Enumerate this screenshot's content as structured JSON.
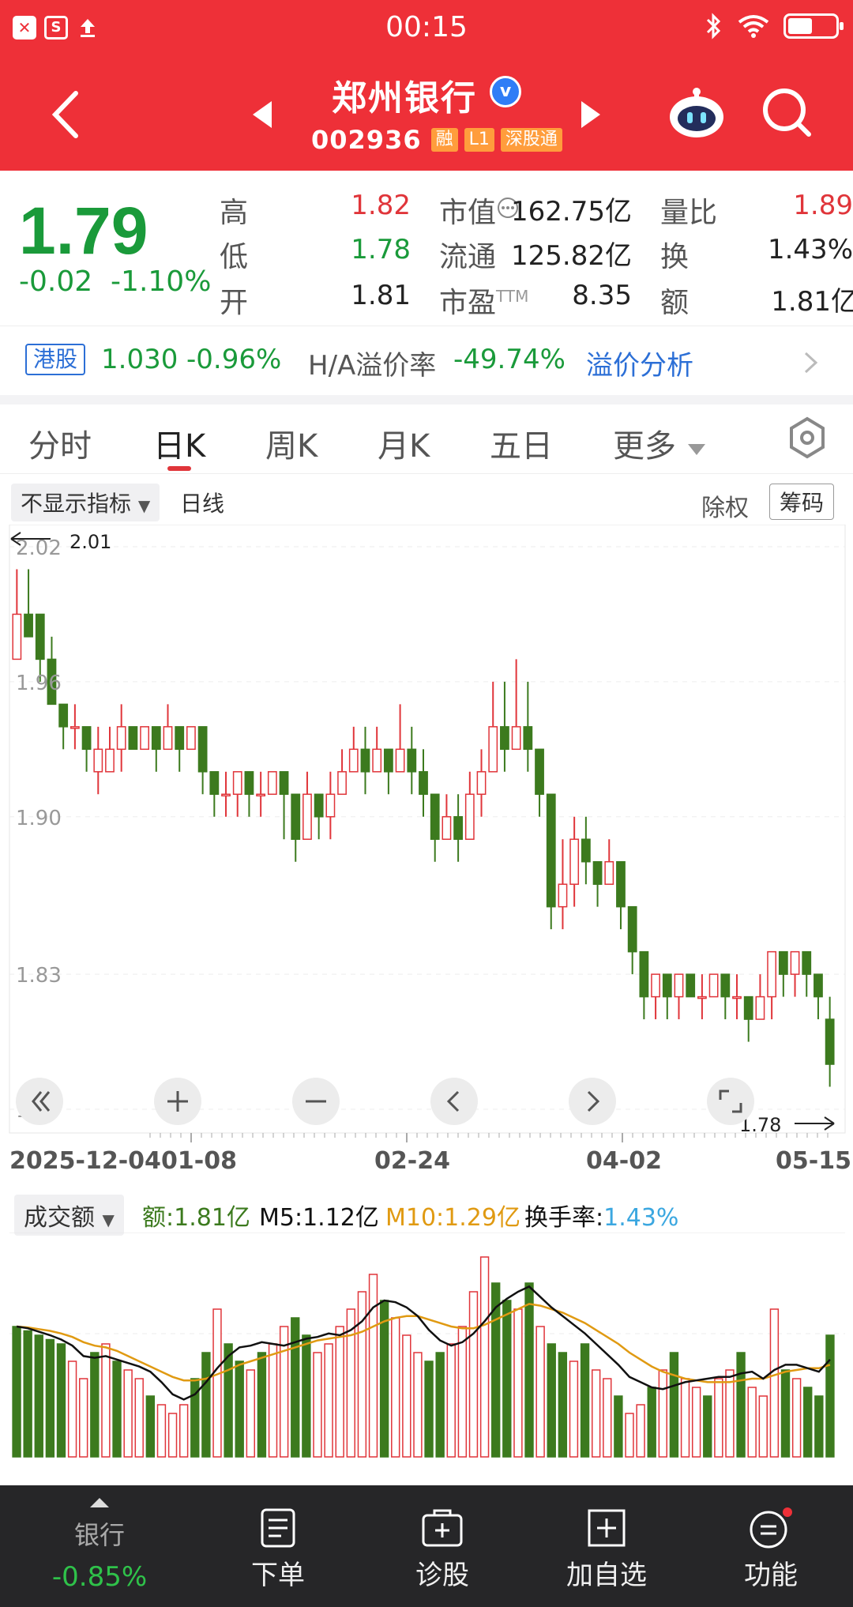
{
  "status_bar": {
    "time": "00:15"
  },
  "header": {
    "stock_name": "郑州银行",
    "verified_mark": "v",
    "stock_code": "002936",
    "tags": [
      "融",
      "L1",
      "深股通"
    ]
  },
  "quote": {
    "price": "1.79",
    "change": "-0.02",
    "change_pct": "-1.10%",
    "high_label": "高",
    "high": "1.82",
    "low_label": "低",
    "low": "1.78",
    "open_label": "开",
    "open": "1.81",
    "mktcap_label": "市值",
    "mktcap": "162.75亿",
    "float_label": "流通",
    "float_cap": "125.82亿",
    "pe_label": "市盈",
    "pe_sup": "TTM",
    "pe": "8.35",
    "volratio_label": "量比",
    "volratio": "1.89",
    "turnover_label": "换",
    "turnover": "1.43%",
    "amount_label": "额",
    "amount": "1.81亿"
  },
  "hk_row": {
    "tag": "港股",
    "price": "1.030",
    "change_pct": "-0.96%",
    "premium_label": "H/A溢价率",
    "premium": "-49.74%",
    "analysis_link": "溢价分析"
  },
  "tabs": [
    "分时",
    "日K",
    "周K",
    "月K",
    "五日",
    "更多"
  ],
  "chart_controls": {
    "indicator_select": "不显示指标",
    "daily_label": "日线",
    "chuquan": "除权",
    "chouma": "筹码"
  },
  "chart_data": {
    "type": "candlestick",
    "y_ticks": [
      "2.02",
      "1.96",
      "1.90",
      "1.83",
      "1.77"
    ],
    "ylim": [
      1.77,
      2.02
    ],
    "max_marker": "2.01",
    "min_marker": "1.78",
    "x_ticks": [
      "2025-12-04",
      "01-08",
      "02-24",
      "04-02",
      "05-15"
    ],
    "colors": {
      "up": "#e0353a",
      "down": "#3c7a1e"
    },
    "candles": [
      {
        "o": 1.97,
        "c": 1.99,
        "h": 2.01,
        "l": 1.97
      },
      {
        "o": 1.99,
        "c": 1.98,
        "h": 2.01,
        "l": 1.98
      },
      {
        "o": 1.99,
        "c": 1.97,
        "h": 1.99,
        "l": 1.96
      },
      {
        "o": 1.97,
        "c": 1.95,
        "h": 1.98,
        "l": 1.95
      },
      {
        "o": 1.95,
        "c": 1.94,
        "h": 1.95,
        "l": 1.93
      },
      {
        "o": 1.94,
        "c": 1.94,
        "h": 1.95,
        "l": 1.93
      },
      {
        "o": 1.94,
        "c": 1.93,
        "h": 1.94,
        "l": 1.92
      },
      {
        "o": 1.92,
        "c": 1.93,
        "h": 1.94,
        "l": 1.91
      },
      {
        "o": 1.92,
        "c": 1.93,
        "h": 1.94,
        "l": 1.92
      },
      {
        "o": 1.93,
        "c": 1.94,
        "h": 1.95,
        "l": 1.92
      },
      {
        "o": 1.94,
        "c": 1.93,
        "h": 1.94,
        "l": 1.93
      },
      {
        "o": 1.93,
        "c": 1.94,
        "h": 1.94,
        "l": 1.93
      },
      {
        "o": 1.94,
        "c": 1.93,
        "h": 1.94,
        "l": 1.92
      },
      {
        "o": 1.93,
        "c": 1.94,
        "h": 1.95,
        "l": 1.93
      },
      {
        "o": 1.94,
        "c": 1.93,
        "h": 1.94,
        "l": 1.92
      },
      {
        "o": 1.93,
        "c": 1.94,
        "h": 1.94,
        "l": 1.93
      },
      {
        "o": 1.94,
        "c": 1.92,
        "h": 1.94,
        "l": 1.91
      },
      {
        "o": 1.92,
        "c": 1.91,
        "h": 1.92,
        "l": 1.9
      },
      {
        "o": 1.91,
        "c": 1.91,
        "h": 1.92,
        "l": 1.9
      },
      {
        "o": 1.91,
        "c": 1.92,
        "h": 1.92,
        "l": 1.9
      },
      {
        "o": 1.92,
        "c": 1.91,
        "h": 1.92,
        "l": 1.9
      },
      {
        "o": 1.91,
        "c": 1.91,
        "h": 1.92,
        "l": 1.9
      },
      {
        "o": 1.91,
        "c": 1.92,
        "h": 1.92,
        "l": 1.91
      },
      {
        "o": 1.92,
        "c": 1.91,
        "h": 1.92,
        "l": 1.89
      },
      {
        "o": 1.91,
        "c": 1.89,
        "h": 1.91,
        "l": 1.88
      },
      {
        "o": 1.89,
        "c": 1.91,
        "h": 1.92,
        "l": 1.89
      },
      {
        "o": 1.91,
        "c": 1.9,
        "h": 1.91,
        "l": 1.89
      },
      {
        "o": 1.9,
        "c": 1.91,
        "h": 1.92,
        "l": 1.89
      },
      {
        "o": 1.91,
        "c": 1.92,
        "h": 1.93,
        "l": 1.91
      },
      {
        "o": 1.92,
        "c": 1.93,
        "h": 1.94,
        "l": 1.92
      },
      {
        "o": 1.93,
        "c": 1.92,
        "h": 1.94,
        "l": 1.91
      },
      {
        "o": 1.92,
        "c": 1.93,
        "h": 1.94,
        "l": 1.92
      },
      {
        "o": 1.93,
        "c": 1.92,
        "h": 1.93,
        "l": 1.91
      },
      {
        "o": 1.92,
        "c": 1.93,
        "h": 1.95,
        "l": 1.92
      },
      {
        "o": 1.93,
        "c": 1.92,
        "h": 1.94,
        "l": 1.91
      },
      {
        "o": 1.92,
        "c": 1.91,
        "h": 1.93,
        "l": 1.9
      },
      {
        "o": 1.91,
        "c": 1.89,
        "h": 1.91,
        "l": 1.88
      },
      {
        "o": 1.89,
        "c": 1.9,
        "h": 1.91,
        "l": 1.89
      },
      {
        "o": 1.9,
        "c": 1.89,
        "h": 1.91,
        "l": 1.88
      },
      {
        "o": 1.89,
        "c": 1.91,
        "h": 1.92,
        "l": 1.89
      },
      {
        "o": 1.91,
        "c": 1.92,
        "h": 1.93,
        "l": 1.9
      },
      {
        "o": 1.92,
        "c": 1.94,
        "h": 1.96,
        "l": 1.92
      },
      {
        "o": 1.94,
        "c": 1.93,
        "h": 1.96,
        "l": 1.92
      },
      {
        "o": 1.93,
        "c": 1.94,
        "h": 1.97,
        "l": 1.93
      },
      {
        "o": 1.94,
        "c": 1.93,
        "h": 1.96,
        "l": 1.92
      },
      {
        "o": 1.93,
        "c": 1.91,
        "h": 1.93,
        "l": 1.9
      },
      {
        "o": 1.91,
        "c": 1.86,
        "h": 1.91,
        "l": 1.85
      },
      {
        "o": 1.86,
        "c": 1.87,
        "h": 1.89,
        "l": 1.85
      },
      {
        "o": 1.87,
        "c": 1.89,
        "h": 1.9,
        "l": 1.86
      },
      {
        "o": 1.89,
        "c": 1.88,
        "h": 1.9,
        "l": 1.87
      },
      {
        "o": 1.88,
        "c": 1.87,
        "h": 1.88,
        "l": 1.86
      },
      {
        "o": 1.87,
        "c": 1.88,
        "h": 1.89,
        "l": 1.87
      },
      {
        "o": 1.88,
        "c": 1.86,
        "h": 1.88,
        "l": 1.85
      },
      {
        "o": 1.86,
        "c": 1.84,
        "h": 1.86,
        "l": 1.83
      },
      {
        "o": 1.84,
        "c": 1.82,
        "h": 1.84,
        "l": 1.81
      },
      {
        "o": 1.82,
        "c": 1.83,
        "h": 1.83,
        "l": 1.81
      },
      {
        "o": 1.83,
        "c": 1.82,
        "h": 1.83,
        "l": 1.81
      },
      {
        "o": 1.82,
        "c": 1.83,
        "h": 1.83,
        "l": 1.81
      },
      {
        "o": 1.83,
        "c": 1.82,
        "h": 1.83,
        "l": 1.82
      },
      {
        "o": 1.82,
        "c": 1.82,
        "h": 1.83,
        "l": 1.81
      },
      {
        "o": 1.82,
        "c": 1.83,
        "h": 1.83,
        "l": 1.82
      },
      {
        "o": 1.83,
        "c": 1.82,
        "h": 1.83,
        "l": 1.81
      },
      {
        "o": 1.82,
        "c": 1.82,
        "h": 1.83,
        "l": 1.81
      },
      {
        "o": 1.82,
        "c": 1.81,
        "h": 1.82,
        "l": 1.8
      },
      {
        "o": 1.81,
        "c": 1.82,
        "h": 1.83,
        "l": 1.81
      },
      {
        "o": 1.82,
        "c": 1.84,
        "h": 1.84,
        "l": 1.81
      },
      {
        "o": 1.84,
        "c": 1.83,
        "h": 1.84,
        "l": 1.82
      },
      {
        "o": 1.83,
        "c": 1.84,
        "h": 1.84,
        "l": 1.82
      },
      {
        "o": 1.84,
        "c": 1.83,
        "h": 1.84,
        "l": 1.82
      },
      {
        "o": 1.83,
        "c": 1.82,
        "h": 1.83,
        "l": 1.81
      },
      {
        "o": 1.81,
        "c": 1.79,
        "h": 1.82,
        "l": 1.78
      }
    ]
  },
  "volume_controls": {
    "select": "成交额",
    "amount": "额:1.81亿",
    "m5": "M5:1.12亿",
    "m10": "M10:1.29亿",
    "turnover": "换手率:1.43%"
  },
  "volume_data": {
    "type": "bar",
    "colors": {
      "up": "#e0353a",
      "down": "#3c7a1e",
      "m5": "#111111",
      "m10": "#e09a12"
    },
    "values": [
      1.5,
      1.45,
      1.4,
      1.35,
      1.3,
      1.1,
      0.9,
      1.2,
      1.3,
      1.1,
      1.0,
      0.9,
      0.7,
      0.6,
      0.5,
      0.6,
      0.9,
      1.2,
      1.7,
      1.3,
      1.1,
      1.0,
      1.2,
      1.3,
      1.5,
      1.6,
      1.4,
      1.2,
      1.3,
      1.5,
      1.7,
      1.9,
      2.1,
      1.8,
      1.6,
      1.4,
      1.2,
      1.1,
      1.2,
      1.3,
      1.5,
      1.9,
      2.3,
      2.0,
      1.8,
      1.7,
      2.0,
      1.5,
      1.3,
      1.2,
      1.1,
      1.3,
      1.0,
      0.9,
      0.7,
      0.5,
      0.6,
      0.8,
      1.0,
      1.2,
      0.9,
      0.8,
      0.7,
      0.9,
      1.0,
      1.2,
      0.8,
      0.7,
      1.7,
      1.0,
      0.9,
      0.8,
      0.7,
      1.4
    ],
    "up": [
      false,
      false,
      false,
      false,
      false,
      true,
      true,
      false,
      true,
      false,
      true,
      true,
      false,
      true,
      true,
      true,
      false,
      false,
      true,
      false,
      false,
      true,
      false,
      true,
      true,
      false,
      false,
      true,
      true,
      true,
      true,
      true,
      true,
      false,
      true,
      true,
      true,
      false,
      false,
      true,
      true,
      true,
      true,
      false,
      false,
      true,
      false,
      true,
      false,
      false,
      true,
      false,
      true,
      true,
      false,
      true,
      true,
      false,
      true,
      false,
      true,
      true,
      false,
      true,
      true,
      false,
      true,
      true,
      true,
      false,
      true,
      false,
      false,
      false
    ],
    "m5": [
      1.5,
      1.48,
      1.44,
      1.4,
      1.35,
      1.28,
      1.16,
      1.14,
      1.16,
      1.12,
      1.08,
      1.04,
      0.98,
      0.86,
      0.72,
      0.66,
      0.72,
      0.86,
      1.02,
      1.16,
      1.26,
      1.28,
      1.32,
      1.3,
      1.28,
      1.32,
      1.36,
      1.38,
      1.42,
      1.4,
      1.46,
      1.56,
      1.72,
      1.8,
      1.78,
      1.72,
      1.62,
      1.46,
      1.34,
      1.28,
      1.32,
      1.42,
      1.56,
      1.72,
      1.82,
      1.9,
      1.96,
      1.84,
      1.72,
      1.62,
      1.52,
      1.42,
      1.3,
      1.18,
      1.06,
      0.92,
      0.86,
      0.8,
      0.78,
      0.82,
      0.86,
      0.88,
      0.9,
      0.92,
      0.92,
      0.96,
      0.98,
      0.9,
      1.0,
      1.06,
      1.06,
      1.02,
      0.98,
      1.12
    ],
    "m10": [
      1.5,
      1.49,
      1.47,
      1.45,
      1.42,
      1.38,
      1.32,
      1.28,
      1.26,
      1.22,
      1.16,
      1.1,
      1.04,
      0.98,
      0.92,
      0.88,
      0.88,
      0.9,
      0.95,
      1.0,
      1.06,
      1.1,
      1.14,
      1.18,
      1.22,
      1.26,
      1.3,
      1.34,
      1.36,
      1.38,
      1.4,
      1.44,
      1.5,
      1.56,
      1.6,
      1.62,
      1.62,
      1.58,
      1.54,
      1.5,
      1.48,
      1.48,
      1.52,
      1.58,
      1.64,
      1.7,
      1.76,
      1.74,
      1.7,
      1.66,
      1.6,
      1.54,
      1.46,
      1.38,
      1.3,
      1.2,
      1.12,
      1.04,
      0.98,
      0.94,
      0.9,
      0.88,
      0.86,
      0.86,
      0.86,
      0.88,
      0.9,
      0.9,
      0.94,
      0.98,
      1.0,
      1.02,
      1.02,
      1.06
    ]
  },
  "bottom_bar": {
    "sector_name": "银行",
    "sector_change": "-0.85%",
    "items": [
      "下单",
      "诊股",
      "加自选",
      "功能"
    ]
  }
}
